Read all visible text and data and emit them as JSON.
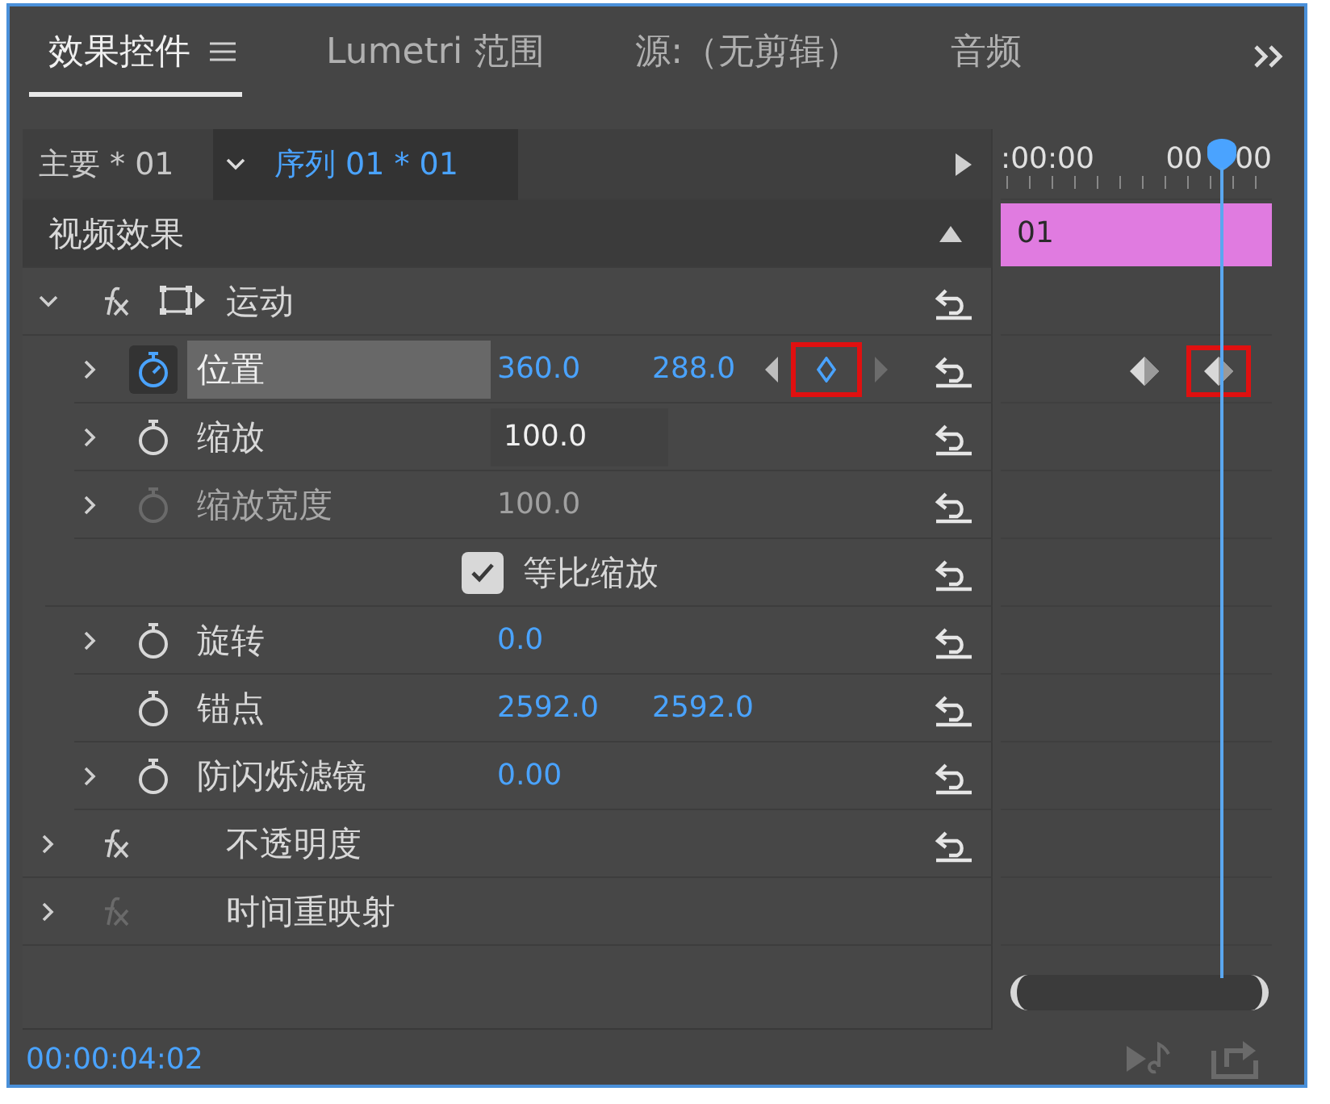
{
  "tabs": [
    {
      "label": "效果控件",
      "selected": true,
      "menu": true
    },
    {
      "label": "Lumetri 范围",
      "selected": false,
      "menu": false
    },
    {
      "label": "源:（无剪辑）",
      "selected": false,
      "menu": false
    },
    {
      "label": "音频",
      "selected": false,
      "menu": false
    }
  ],
  "header": {
    "master": "主要 * 01",
    "sequence": "序列 01 * 01",
    "ruler": [
      ":00:00",
      "00",
      "00"
    ]
  },
  "section": {
    "title": "视频效果",
    "expanded": true,
    "clip": {
      "label": "01",
      "color": "#e07be0"
    }
  },
  "effects": [
    {
      "kind": "effect",
      "name": "运动",
      "expanded": true,
      "enabled": true,
      "transform_icon": true,
      "resettable": true,
      "children": [
        {
          "kind": "property",
          "name": "位置",
          "expandable": true,
          "animated": true,
          "selected": true,
          "disabled": false,
          "editing": false,
          "values": [
            "360.0",
            "288.0"
          ],
          "keyframe_nav": {
            "highlighted": true
          },
          "keyframes": [
            {
              "at_playhead": false,
              "highlighted": false
            },
            {
              "at_playhead": true,
              "highlighted": true
            }
          ],
          "resettable": true
        },
        {
          "kind": "property",
          "name": "缩放",
          "expandable": true,
          "animated": false,
          "selected": false,
          "disabled": false,
          "editing": true,
          "values": [
            "100.0"
          ],
          "resettable": true
        },
        {
          "kind": "property",
          "name": "缩放宽度",
          "expandable": true,
          "animated": false,
          "selected": false,
          "disabled": true,
          "editing": false,
          "values": [
            "100.0"
          ],
          "resettable": true
        },
        {
          "kind": "checkbox",
          "label": "等比缩放",
          "checked": true,
          "resettable": true
        },
        {
          "kind": "property",
          "name": "旋转",
          "expandable": true,
          "animated": false,
          "selected": false,
          "disabled": false,
          "editing": false,
          "values": [
            "0.0"
          ],
          "resettable": true
        },
        {
          "kind": "property",
          "name": "锚点",
          "expandable": false,
          "animated": false,
          "selected": false,
          "disabled": false,
          "editing": false,
          "values": [
            "2592.0",
            "2592.0"
          ],
          "resettable": true
        },
        {
          "kind": "property",
          "name": "防闪烁滤镜",
          "expandable": true,
          "animated": false,
          "selected": false,
          "disabled": false,
          "editing": false,
          "values": [
            "0.00"
          ],
          "resettable": true
        }
      ]
    },
    {
      "kind": "effect",
      "name": "不透明度",
      "expanded": false,
      "enabled": true,
      "transform_icon": false,
      "resettable": true
    },
    {
      "kind": "effect",
      "name": "时间重映射",
      "expanded": false,
      "enabled": false,
      "transform_icon": false,
      "resettable": false
    }
  ],
  "timecode": "00:00:04:02"
}
